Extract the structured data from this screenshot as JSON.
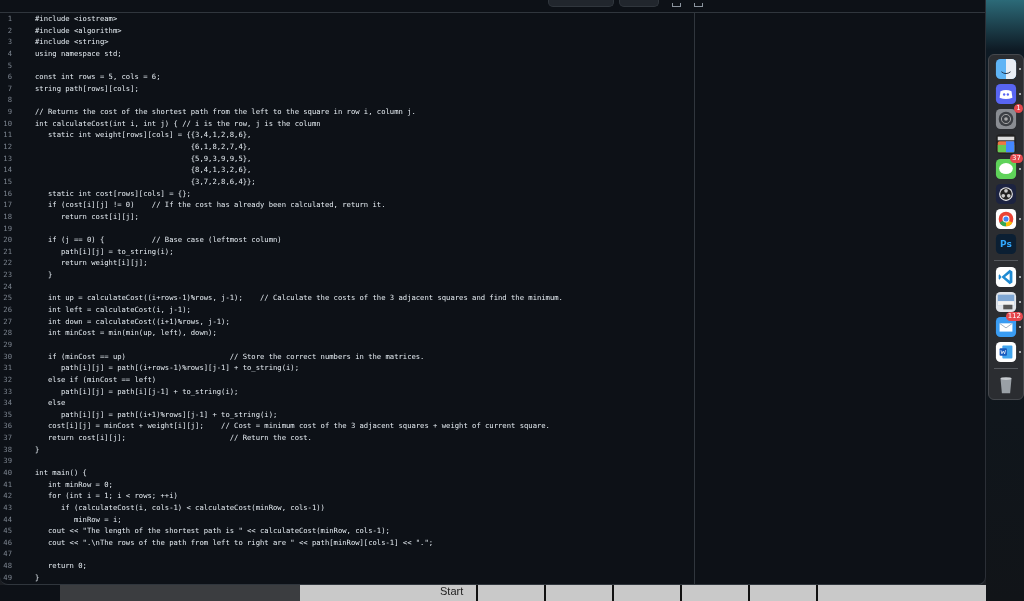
{
  "code": {
    "lines": [
      {
        "number": "1",
        "text": "#include <iostream>"
      },
      {
        "number": "2",
        "text": "#include <algorithm>"
      },
      {
        "number": "3",
        "text": "#include <string>"
      },
      {
        "number": "4",
        "text": "using namespace std;"
      },
      {
        "number": "5"
      },
      {
        "number": "6",
        "text": "const int rows = 5, cols = 6;"
      },
      {
        "number": "7",
        "text": "string path[rows][cols];"
      },
      {
        "number": "8"
      },
      {
        "number": "9",
        "text": "// Returns the cost of the shortest path from the left to the square in row i, column j."
      },
      {
        "number": "10",
        "text": "int calculateCost(int i, int j) { // i is the row, j is the column"
      },
      {
        "number": "11",
        "text": "   static int weight[rows][cols] = {{3,4,1,2,8,6},"
      },
      {
        "number": "12",
        "text": "                                    {6,1,8,2,7,4},"
      },
      {
        "number": "13",
        "text": "                                    {5,9,3,9,9,5},"
      },
      {
        "number": "14",
        "text": "                                    {8,4,1,3,2,6},"
      },
      {
        "number": "15",
        "text": "                                    {3,7,2,8,6,4}};"
      },
      {
        "number": "16",
        "text": "   static int cost[rows][cols] = {};"
      },
      {
        "number": "17",
        "text": "   if (cost[i][j] != 0)    // If the cost has already been calculated, return it."
      },
      {
        "number": "18",
        "text": "      return cost[i][j];"
      },
      {
        "number": "19"
      },
      {
        "number": "20",
        "text": "   if (j == 0) {           // Base case (leftmost column)"
      },
      {
        "number": "21",
        "text": "      path[i][j] = to_string(i);"
      },
      {
        "number": "22",
        "text": "      return weight[i][j];"
      },
      {
        "number": "23",
        "text": "   }"
      },
      {
        "number": "24"
      },
      {
        "number": "25",
        "text": "   int up = calculateCost((i+rows-1)%rows, j-1);    // Calculate the costs of the 3 adjacent squares and find the minimum."
      },
      {
        "number": "26",
        "text": "   int left = calculateCost(i, j-1);"
      },
      {
        "number": "27",
        "text": "   int down = calculateCost((i+1)%rows, j-1);"
      },
      {
        "number": "28",
        "text": "   int minCost = min(min(up, left), down);"
      },
      {
        "number": "29"
      },
      {
        "number": "30",
        "text": "   if (minCost == up)                        // Store the correct numbers in the matrices."
      },
      {
        "number": "31",
        "text": "      path[i][j] = path[(i+rows-1)%rows][j-1] + to_string(i);"
      },
      {
        "number": "32",
        "text": "   else if (minCost == left)"
      },
      {
        "number": "33",
        "text": "      path[i][j] = path[i][j-1] + to_string(i);"
      },
      {
        "number": "34",
        "text": "   else"
      },
      {
        "number": "35",
        "text": "      path[i][j] = path[(i+1)%rows][j-1] + to_string(i);"
      },
      {
        "number": "36",
        "text": "   cost[i][j] = minCost + weight[i][j];    // Cost = minimum cost of the 3 adjacent squares + weight of current square."
      },
      {
        "number": "37",
        "text": "   return cost[i][j];                        // Return the cost."
      },
      {
        "number": "38",
        "text": "}"
      },
      {
        "number": "39"
      },
      {
        "number": "40",
        "text": "int main() {"
      },
      {
        "number": "41",
        "text": "   int minRow = 0;"
      },
      {
        "number": "42",
        "text": "   for (int i = 1; i < rows; ++i)"
      },
      {
        "number": "43",
        "text": "      if (calculateCost(i, cols-1) < calculateCost(minRow, cols-1))"
      },
      {
        "number": "44",
        "text": "         minRow = i;"
      },
      {
        "number": "45",
        "text": "   cout << \"The length of the shortest path is \" << calculateCost(minRow, cols-1);"
      },
      {
        "number": "46",
        "text": "   cout << \".\\nThe rows of the path from left to right are \" << path[minRow][cols-1] << \".\";"
      },
      {
        "number": "47"
      },
      {
        "number": "48",
        "text": "   return 0;"
      },
      {
        "number": "49",
        "text": "}"
      }
    ]
  },
  "dock": {
    "apps": [
      {
        "kind": "finder",
        "running": true
      },
      {
        "kind": "discord",
        "running": true
      },
      {
        "kind": "settings",
        "running": false,
        "badge": "1"
      },
      {
        "kind": "video",
        "running": false
      },
      {
        "kind": "messages",
        "running": true,
        "badge": "37"
      },
      {
        "kind": "obs",
        "running": false
      },
      {
        "kind": "chrome",
        "running": true
      },
      {
        "kind": "photoshop",
        "running": false,
        "label": "Ps"
      },
      {
        "kind": "separator"
      },
      {
        "kind": "vscode",
        "running": true
      },
      {
        "kind": "preview",
        "running": true
      },
      {
        "kind": "mail",
        "running": true,
        "badge": "112"
      },
      {
        "kind": "word",
        "running": true
      },
      {
        "kind": "separator"
      },
      {
        "kind": "trash",
        "running": false
      }
    ]
  },
  "background_window": {
    "label": "Start"
  }
}
